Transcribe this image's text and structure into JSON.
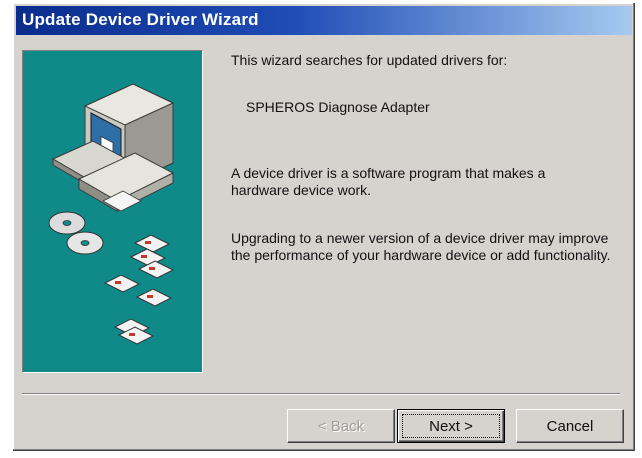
{
  "window": {
    "title": "Update Device Driver Wizard"
  },
  "content": {
    "intro": "This wizard searches for updated drivers for:",
    "device_name": "SPHEROS Diagnose Adapter",
    "description": "A device driver is a software program that makes a hardware device work.",
    "upgrade_info": "Upgrading to a newer version of a device driver may improve the performance of your hardware device or add functionality."
  },
  "buttons": {
    "back": "< Back",
    "next": "Next >",
    "cancel": "Cancel"
  },
  "icons": {
    "panel": [
      "computer-icon",
      "cd-icon",
      "floppy-disk-icon"
    ]
  },
  "colors": {
    "titlebar_start": "#0a2c8c",
    "titlebar_end": "#a6caf0",
    "panel_background": "#108a88",
    "window_background": "#d6d3ce"
  }
}
